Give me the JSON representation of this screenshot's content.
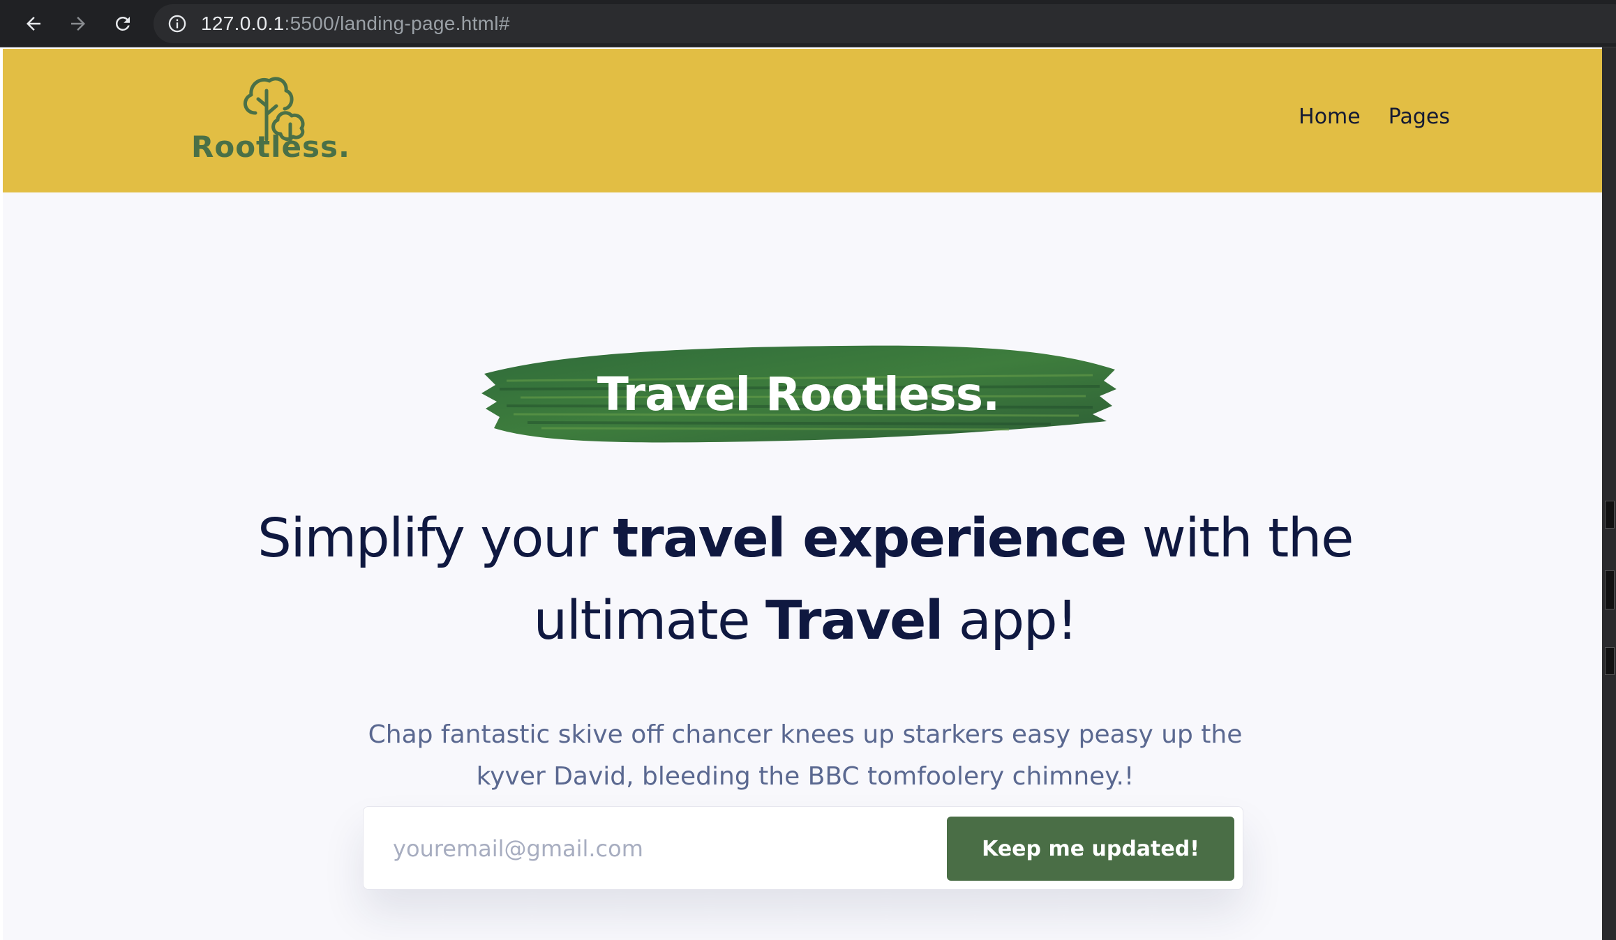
{
  "browser": {
    "url_host": "127.0.0.1",
    "url_path": ":5500/landing-page.html#",
    "icons": [
      "back-arrow-icon",
      "forward-arrow-icon",
      "reload-icon",
      "info-icon"
    ]
  },
  "header": {
    "logo_text": "Rootless.",
    "nav": [
      {
        "label": "Home"
      },
      {
        "label": "Pages"
      }
    ],
    "colors": {
      "background": "#e2be44",
      "logo": "#4a7047"
    }
  },
  "hero": {
    "badge": "Travel Rootless.",
    "headline": {
      "p1": "Simplify your ",
      "b1": "travel experience",
      "p2": " with the ultimate ",
      "b2": "Travel",
      "p3": " app!"
    },
    "subtext": "Chap fantastic skive off chancer knees up starkers easy peasy up the kyver David, bleeding the BBC tomfoolery chimney.!"
  },
  "signup": {
    "placeholder": "youremail@gmail.com",
    "button_label": "Keep me updated!",
    "colors": {
      "button": "#4a6e46"
    }
  }
}
